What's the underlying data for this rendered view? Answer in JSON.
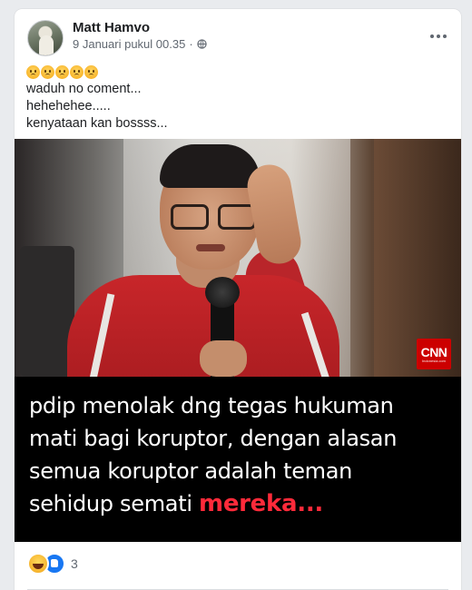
{
  "post": {
    "author": "Matt Hamvo",
    "timestamp": "9 Januari pukul 00.35",
    "separator": "·",
    "privacy_icon": "globe-icon",
    "more_icon": "more-options-icon",
    "emoji_row": [
      "weary-face-emoji",
      "weary-face-emoji",
      "weary-face-emoji",
      "weary-face-emoji",
      "weary-face-emoji"
    ],
    "text_lines": [
      "waduh no coment...",
      "hehehehee.....",
      "kenyataan kan bossss..."
    ]
  },
  "image": {
    "logo_text": "CNN",
    "logo_subtext": "Indonesia.com",
    "caption_lines": [
      "pdip menolak dng  tegas hukuman",
      "mati bagi koruptor, dengan alasan",
      " semua koruptor  adalah teman",
      " sehidup semati "
    ],
    "caption_highlight": "mereka...",
    "highlight_color": "#ff2a3a"
  },
  "footer": {
    "reaction_icons": [
      "haha-reaction-icon",
      "like-reaction-icon"
    ],
    "reaction_count": "3"
  },
  "colors": {
    "card_bg": "#ffffff",
    "page_bg": "#e9ebee",
    "text_primary": "#1c1e21",
    "text_secondary": "#606770",
    "like_blue": "#1877f2",
    "cnn_red": "#cc0000"
  }
}
